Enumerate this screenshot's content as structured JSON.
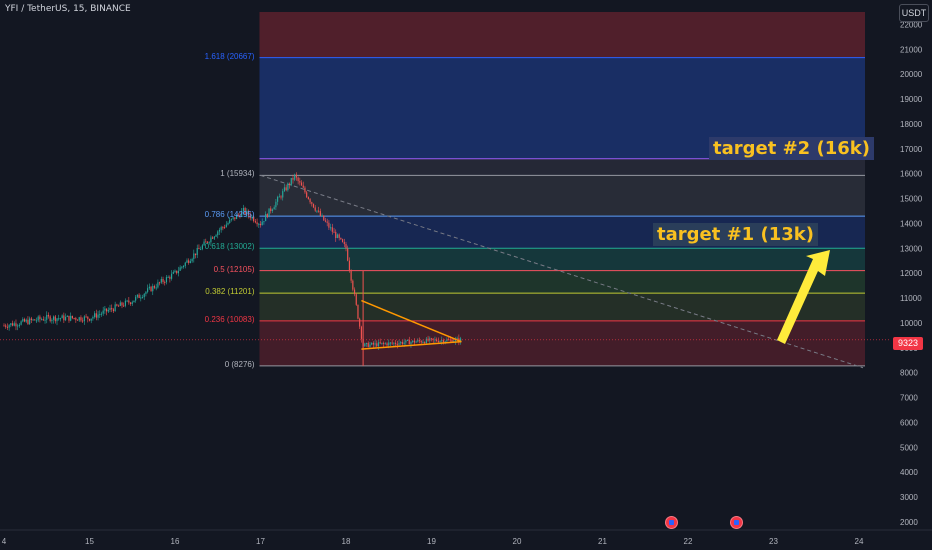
{
  "header": {
    "title": "YFI / TetherUS, 15, BINANCE",
    "unit": "USDT"
  },
  "current_price": "9323",
  "price_axis": [
    "22000",
    "21000",
    "20000",
    "19000",
    "18000",
    "17000",
    "16000",
    "15000",
    "14000",
    "13000",
    "12000",
    "11000",
    "10000",
    "9000",
    "8000",
    "7000",
    "6000",
    "5000",
    "4000",
    "3000",
    "2000"
  ],
  "time_axis": [
    "4",
    "15",
    "16",
    "17",
    "18",
    "19",
    "20",
    "21",
    "22",
    "23",
    "24"
  ],
  "fib_levels": [
    {
      "label": "1.618 (20667)",
      "price": 20667,
      "color": "#2962ff"
    },
    {
      "label": "1 (15934)",
      "price": 15934,
      "color": "#9598a1"
    },
    {
      "label": "0.786 (14295)",
      "price": 14295,
      "color": "#5b9cf6"
    },
    {
      "label": "0.618 (13002)",
      "price": 13002,
      "color": "#22ab94"
    },
    {
      "label": "0.5 (12105)",
      "price": 12105,
      "color": "#f7525f"
    },
    {
      "label": "0.382 (11201)",
      "price": 11201,
      "color": "#c0ca33"
    },
    {
      "label": "0.236 (10083)",
      "price": 10083,
      "color": "#f23645"
    },
    {
      "label": "0 (8276)",
      "price": 8276,
      "color": "#9598a1"
    }
  ],
  "annotations": {
    "target1": "target #1 (13k)",
    "target2": "target #2 (16k)"
  },
  "colors": {
    "up": "#26a69a",
    "down": "#ef5350",
    "triangle": "#ff9800",
    "arrow": "#ffeb3b",
    "background": "#131722"
  },
  "chart_data": {
    "type": "candlestick",
    "title": "YFI / TetherUS, 15, BINANCE",
    "ylim": [
      2000,
      22000
    ],
    "x_days": [
      14,
      24
    ],
    "approx_close_path": [
      {
        "day": 14.0,
        "price": 9900
      },
      {
        "day": 14.5,
        "price": 10200
      },
      {
        "day": 15.0,
        "price": 10200
      },
      {
        "day": 15.5,
        "price": 10900
      },
      {
        "day": 16.0,
        "price": 12000
      },
      {
        "day": 16.5,
        "price": 13700
      },
      {
        "day": 16.8,
        "price": 14500
      },
      {
        "day": 17.0,
        "price": 14000
      },
      {
        "day": 17.4,
        "price": 15900
      },
      {
        "day": 17.7,
        "price": 14300
      },
      {
        "day": 18.0,
        "price": 13000
      },
      {
        "day": 18.2,
        "price": 9100
      },
      {
        "day": 18.6,
        "price": 9200
      },
      {
        "day": 19.0,
        "price": 9300
      },
      {
        "day": 19.35,
        "price": 9323
      }
    ],
    "fib_retracement": {
      "start_day": 17.0,
      "end_day": 24.0,
      "low": 8276,
      "high": 15934
    },
    "target_lines": [
      {
        "label": "target #1 (13k)",
        "price": 13000
      },
      {
        "label": "target #2 (16k)",
        "price": 16600
      }
    ]
  }
}
